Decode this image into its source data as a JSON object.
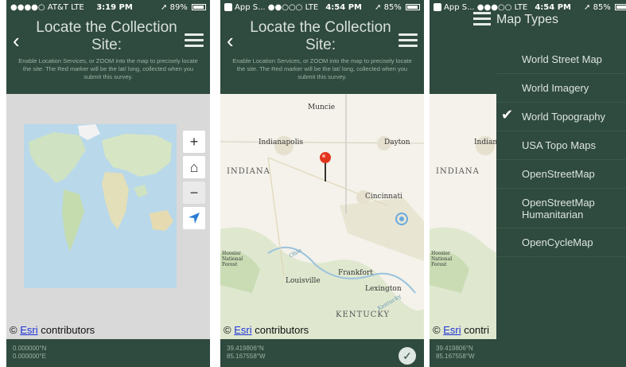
{
  "screen1": {
    "status": {
      "carrier": "●●●●○ AT&T  LTE",
      "time": "3:19 PM",
      "battery": "89%"
    },
    "title": "Locate the Collection Site:",
    "subtitle": "Enable Location Services, or ZOOM into the map to precisely locate the site. The Red marker will be the lat/ long, collected when you submit this survey.",
    "attribution_prefix": "©",
    "attribution_link": "Esri",
    "attribution_suffix": "contributors",
    "coord_lat": "0.000000°N",
    "coord_lon": "0.000000°E",
    "controls": {
      "zoom_in": "+",
      "home": "⌂",
      "zoom_out": "−",
      "locate": "➤"
    }
  },
  "screen2": {
    "status": {
      "carrier": "App S...  ●●○○○  LTE",
      "time": "4:54 PM",
      "battery": "85%"
    },
    "title": "Locate the Collection Site:",
    "subtitle": "Enable Location Services, or ZOOM into the map to precisely locate the site. The Red marker will be the lat/ long, collected when you submit this survey.",
    "attribution_prefix": "©",
    "attribution_link": "Esri",
    "attribution_suffix": "contributors",
    "coord_lat": "39.419806°N",
    "coord_lon": "85.167558°W",
    "check": "✓",
    "map_labels": {
      "muncie": "Muncie",
      "indianapolis": "Indianapolis",
      "dayton": "Dayton",
      "indiana": "INDIANA",
      "cincinnati": "Cincinnati",
      "hoosier": "Hoosier National Forest",
      "frankfort": "Frankfort",
      "louisville": "Louisville",
      "lexington": "Lexington",
      "kentucky": "KENTUCKY",
      "ohio_river": "Ohio",
      "kentucky_river": "Kentucky"
    }
  },
  "screen3": {
    "status": {
      "carrier": "App S...  ●●●○○  LTE",
      "time": "4:54 PM",
      "battery": "85%"
    },
    "menu_title": "Map Types",
    "attribution_prefix": "©",
    "attribution_link": "Esri",
    "attribution_suffix": "contri",
    "coord_lat": "39.419806°N",
    "coord_lon": "85.167558°W",
    "partial_labels": {
      "indiana": "INDIANA",
      "indian": "Indian",
      "hoosier": "Hoosier National Forest"
    },
    "menu_items": [
      {
        "label": "World Street Map",
        "selected": false
      },
      {
        "label": "World Imagery",
        "selected": false
      },
      {
        "label": "World Topography",
        "selected": true
      },
      {
        "label": "USA Topo Maps",
        "selected": false
      },
      {
        "label": "OpenStreetMap",
        "selected": false
      },
      {
        "label": "OpenStreetMap Humanitarian",
        "selected": false
      },
      {
        "label": "OpenCycleMap",
        "selected": false
      }
    ],
    "check_glyph": "✔"
  },
  "colors": {
    "header_bg": "#2f4a3e",
    "esri_link": "#1d33d6",
    "pin_red": "#e2351e"
  }
}
